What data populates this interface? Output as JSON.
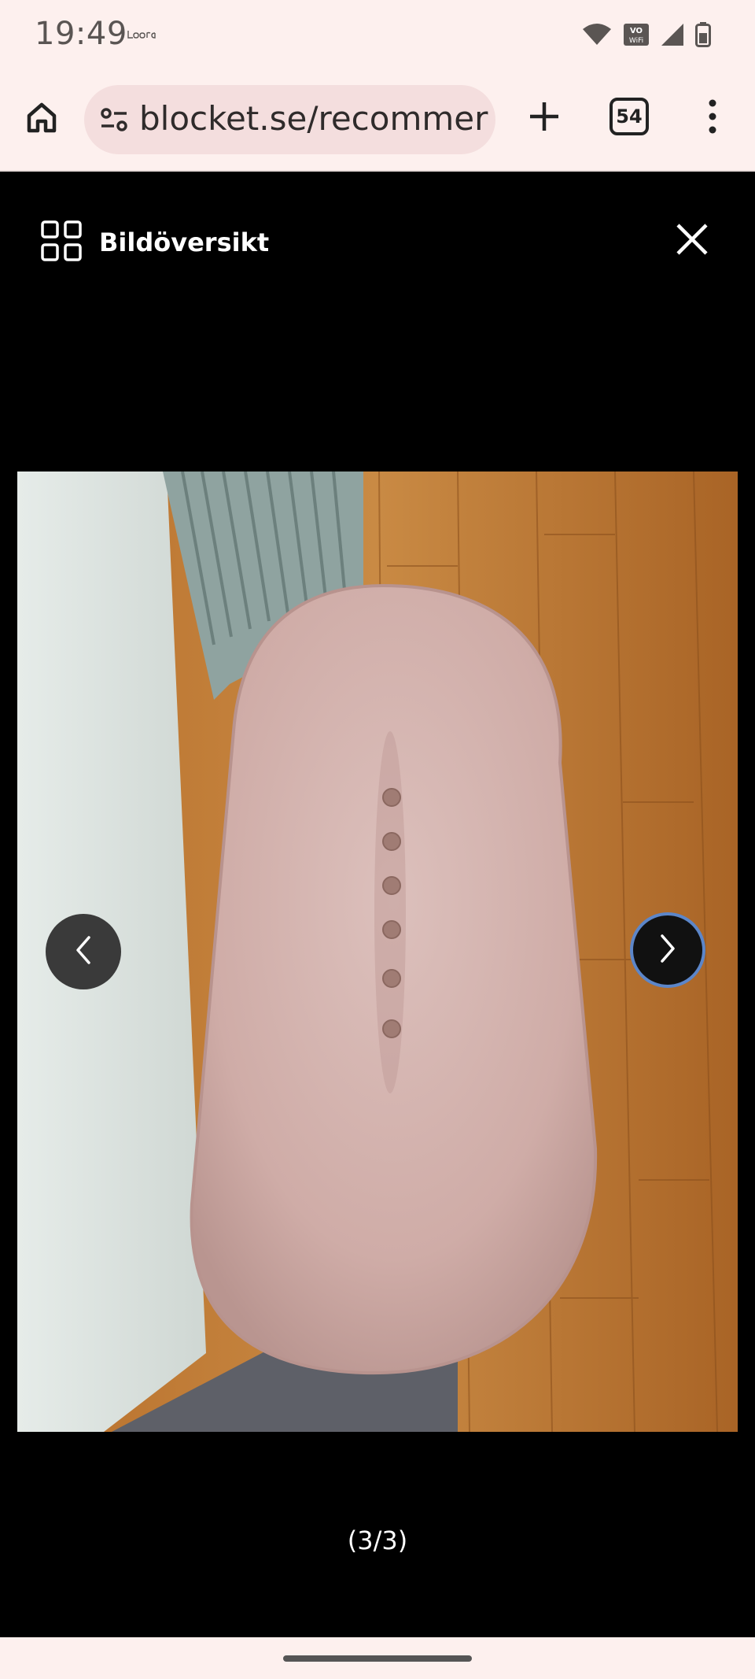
{
  "status_bar": {
    "time": "19:49",
    "carrier_logo": "Looro",
    "icons": [
      "wifi-icon",
      "vowifi-icon",
      "signal-icon",
      "battery-icon"
    ]
  },
  "browser": {
    "url": "blocket.se/recommer",
    "tab_count": "54",
    "icons": [
      "home-icon",
      "site-settings-icon",
      "new-tab-icon",
      "tab-switcher-icon",
      "more-menu-icon"
    ]
  },
  "viewer": {
    "overview_label": "Bildöversikt",
    "counter": "(3/3)",
    "image_alt": "Pink velvet oval bench with buttons on wooden floor",
    "icons": [
      "grid-icon",
      "close-icon",
      "chevron-left-icon",
      "chevron-right-icon"
    ]
  },
  "colors": {
    "chrome_bg": "#fdf0ee",
    "url_pill_bg": "#f4dede",
    "viewer_bg": "#000000",
    "focus_ring": "#5c86c9"
  }
}
